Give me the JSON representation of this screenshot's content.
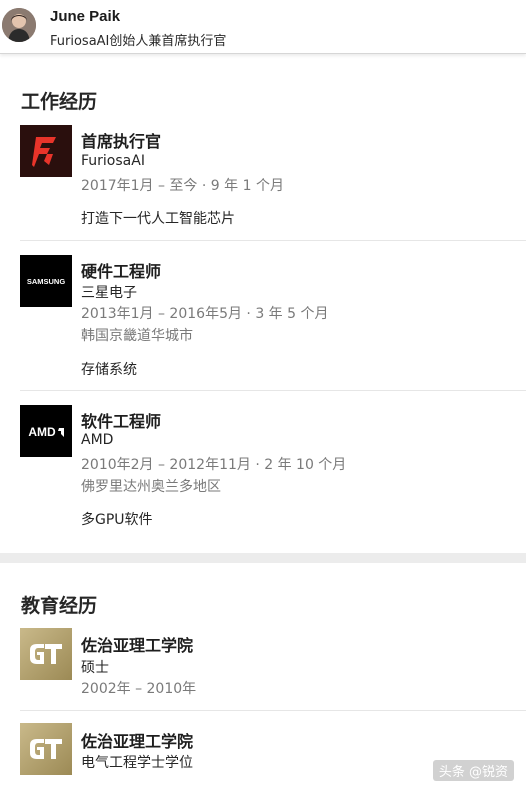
{
  "profile": {
    "name": "June Paik",
    "headline": "FuriosaAI创始人兼首席执行官"
  },
  "experience": {
    "section_title": "工作经历",
    "items": [
      {
        "logo": "furiosa-logo",
        "title": "首席执行官",
        "company": "FuriosaAI",
        "dates": "2017年1月 – 至今 · 9 年 1 个月",
        "location": "",
        "description": "打造下一代人工智能芯片"
      },
      {
        "logo": "samsung-logo",
        "logo_text": "SAMSUNG",
        "title": "硬件工程师",
        "company": "三星电子",
        "dates": "2013年1月 – 2016年5月 · 3 年 5 个月",
        "location": "韩国京畿道华城市",
        "description": "存储系统"
      },
      {
        "logo": "amd-logo",
        "logo_text": "AMD",
        "title": "软件工程师",
        "company": "AMD",
        "dates": "2010年2月 – 2012年11月 · 2 年 10 个月",
        "location": "佛罗里达州奥兰多地区",
        "description": "多GPU软件"
      }
    ]
  },
  "education": {
    "section_title": "教育经历",
    "items": [
      {
        "logo": "georgia-tech-logo",
        "school": "佐治亚理工学院",
        "degree": "硕士",
        "dates": "2002年 – 2010年"
      },
      {
        "logo": "georgia-tech-logo",
        "school": "佐治亚理工学院",
        "degree": "电气工程学士学位",
        "dates": ""
      }
    ]
  },
  "watermark": "头条 @锐资",
  "colors": {
    "divider": "#ececec",
    "meta_text": "#7a7a7a",
    "furiosa_red": "#e8342a",
    "gt_gold": "#b3a369"
  }
}
